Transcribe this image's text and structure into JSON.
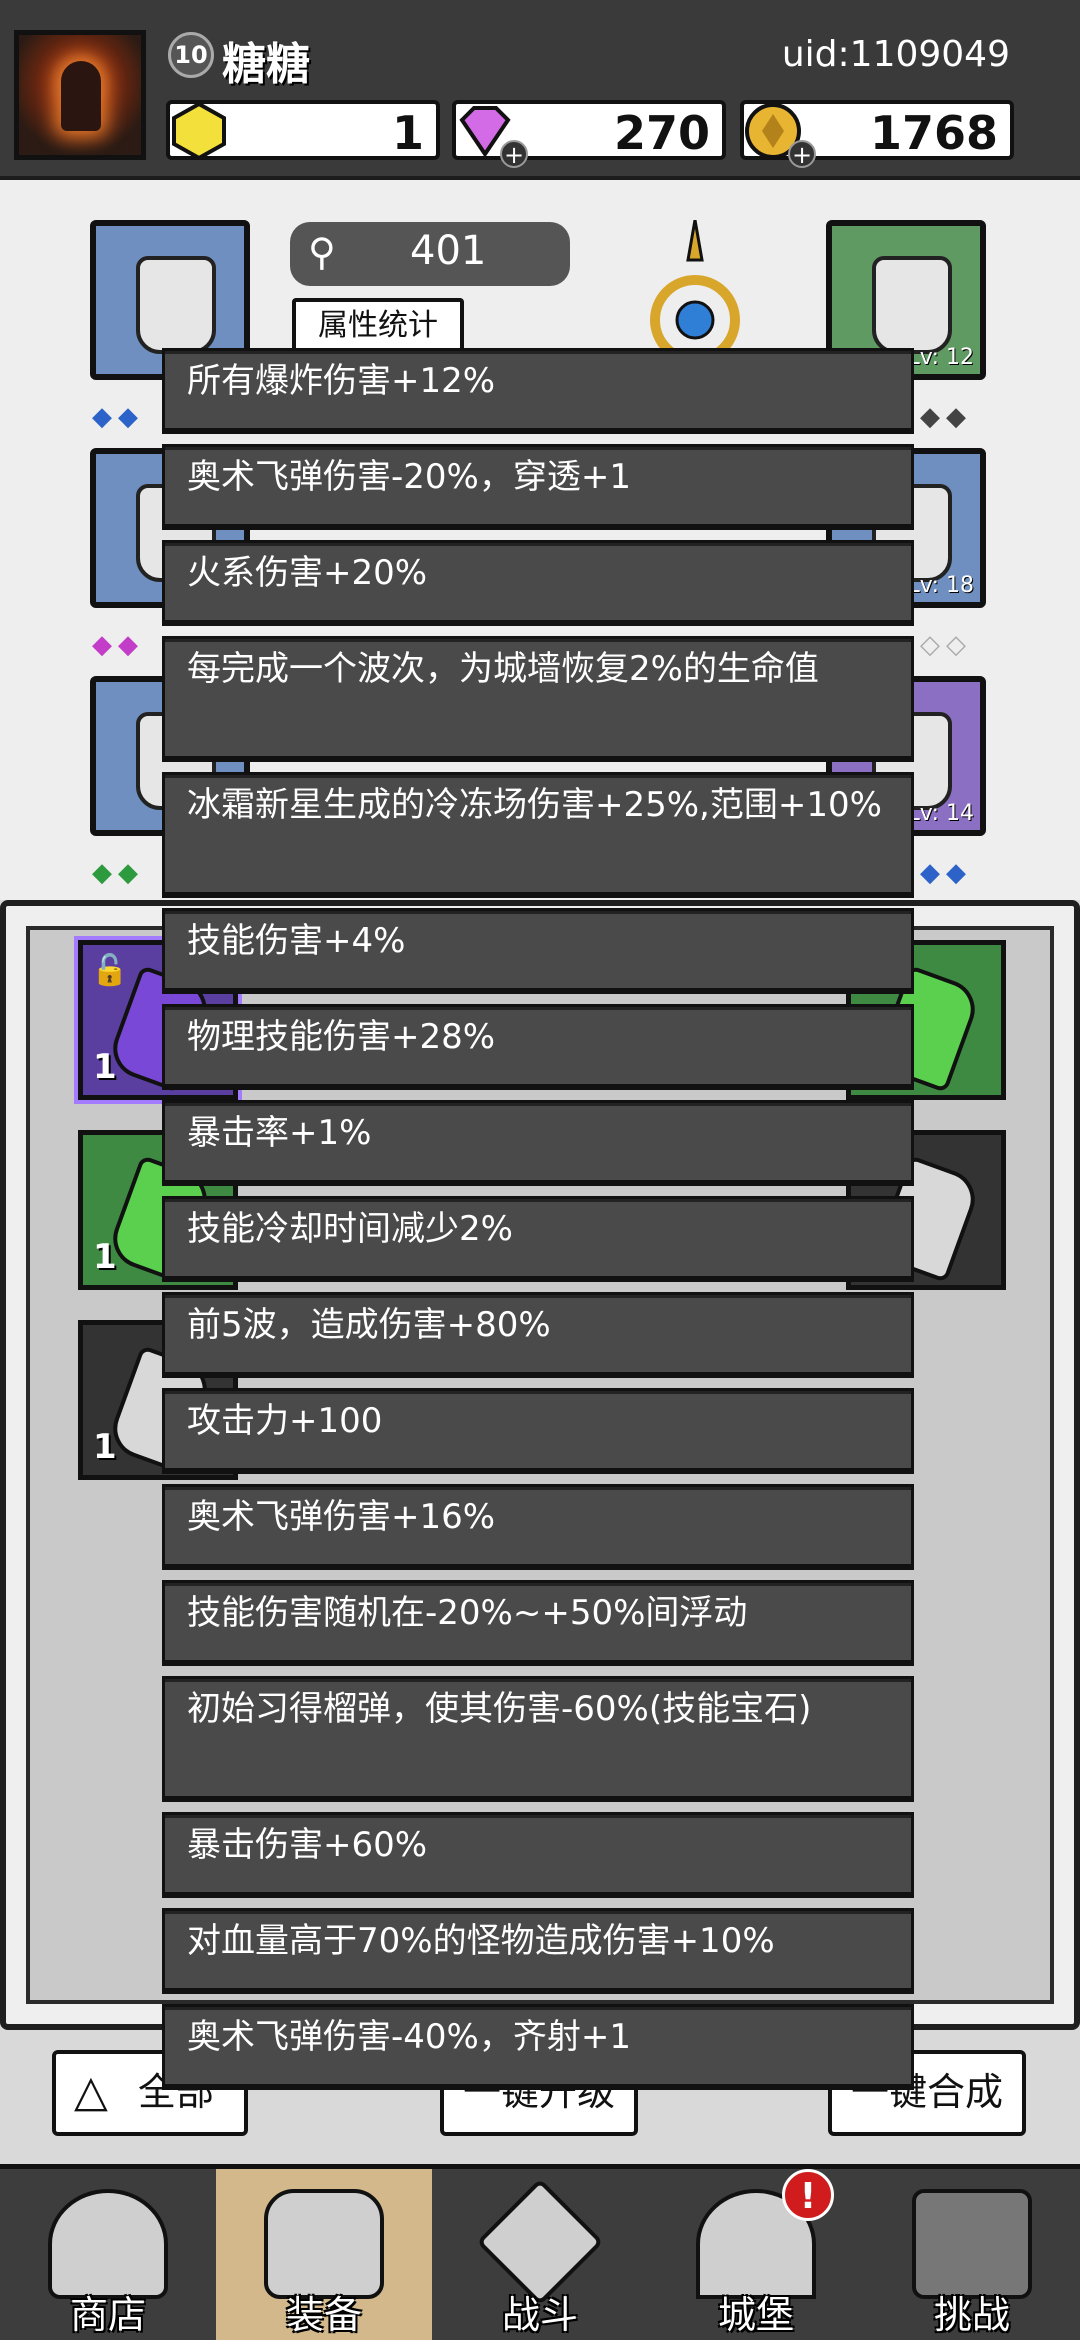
{
  "player": {
    "level": "10",
    "name": "糖糖",
    "uid": "uid:1109049"
  },
  "currencies": [
    {
      "icon": "yellow-gem-icon",
      "value": "1"
    },
    {
      "icon": "purple-diamond-icon",
      "value": "270"
    },
    {
      "icon": "gold-coin-icon",
      "value": "1768"
    }
  ],
  "equipment": {
    "power": "401",
    "stats_button": "属性统计",
    "slots": [
      {
        "label": "Lv: 12",
        "color": "green"
      },
      {
        "label": "Lv: 18",
        "color": "blue"
      },
      {
        "label": "Lv: 14",
        "color": "purple"
      }
    ]
  },
  "inventory": {
    "counts": [
      "1",
      "1",
      "1"
    ]
  },
  "actions": {
    "all_label": "全部",
    "upgrade_label": "一键升级",
    "merge_label": "一键合成"
  },
  "attributes": [
    "所有爆炸伤害+12%",
    "奥术飞弹伤害-20%，穿透+1",
    "火系伤害+20%",
    "每完成一个波次，为城墙恢复2%的生命值",
    "冰霜新星生成的冷冻场伤害+25%,范围+10%",
    "技能伤害+4%",
    "物理技能伤害+28%",
    "暴击率+1%",
    "技能冷却时间减少2%",
    "前5波，造成伤害+80%",
    "攻击力+100",
    "奥术飞弹伤害+16%",
    "技能伤害随机在-20%~+50%间浮动",
    "初始习得榴弹，使其伤害-60%(技能宝石)",
    "暴击伤害+60%",
    "对血量高于70%的怪物造成伤害+10%",
    "奥术飞弹伤害-40%，齐射+1"
  ],
  "nav": [
    {
      "label": "商店",
      "icon": "shop-icon"
    },
    {
      "label": "装备",
      "icon": "backpack-icon"
    },
    {
      "label": "战斗",
      "icon": "crossed-swords-icon"
    },
    {
      "label": "城堡",
      "icon": "castle-icon"
    },
    {
      "label": "挑战",
      "icon": "locked-challenge-icon"
    }
  ],
  "nav_alert": "!"
}
